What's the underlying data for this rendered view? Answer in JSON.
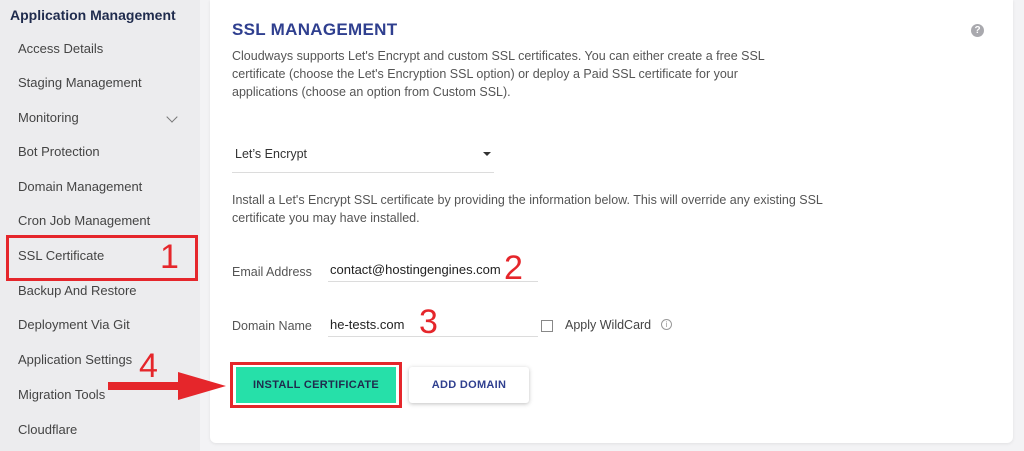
{
  "sidebar": {
    "title": "Application Management",
    "items": [
      {
        "label": "Access Details"
      },
      {
        "label": "Staging Management"
      },
      {
        "label": "Monitoring"
      },
      {
        "label": "Bot Protection"
      },
      {
        "label": "Domain Management"
      },
      {
        "label": "Cron Job Management"
      },
      {
        "label": "SSL Certificate"
      },
      {
        "label": "Backup And Restore"
      },
      {
        "label": "Deployment Via Git"
      },
      {
        "label": "Application Settings"
      },
      {
        "label": "Migration Tools"
      },
      {
        "label": "Cloudflare"
      }
    ]
  },
  "main": {
    "title": "SSL MANAGEMENT",
    "help_icon": "?",
    "description": "Cloudways supports Let's Encrypt and custom SSL certificates. You can either create a free SSL certificate (choose the Let's Encryption SSL option) or deploy a Paid SSL certificate for your applications (choose an option from Custom SSL).",
    "ssl_type": "Let’s Encrypt",
    "info": "Install a Let's Encrypt SSL certificate by providing the information below. This will override any existing SSL certificate you may have installed.",
    "email_label": "Email Address",
    "email_value": "contact@hostingengines.com",
    "domain_label": "Domain Name",
    "domain_value": "he-tests.com",
    "wildcard_label": "Apply WildCard",
    "info_icon": "i",
    "install_button": "INSTALL CERTIFICATE",
    "add_domain_button": "ADD DOMAIN"
  },
  "annotations": {
    "step1": "1",
    "step2": "2",
    "step3": "3",
    "step4": "4",
    "color": "#e5262b"
  },
  "colors": {
    "accent": "#26e0a9",
    "title": "#2f3f8f"
  }
}
